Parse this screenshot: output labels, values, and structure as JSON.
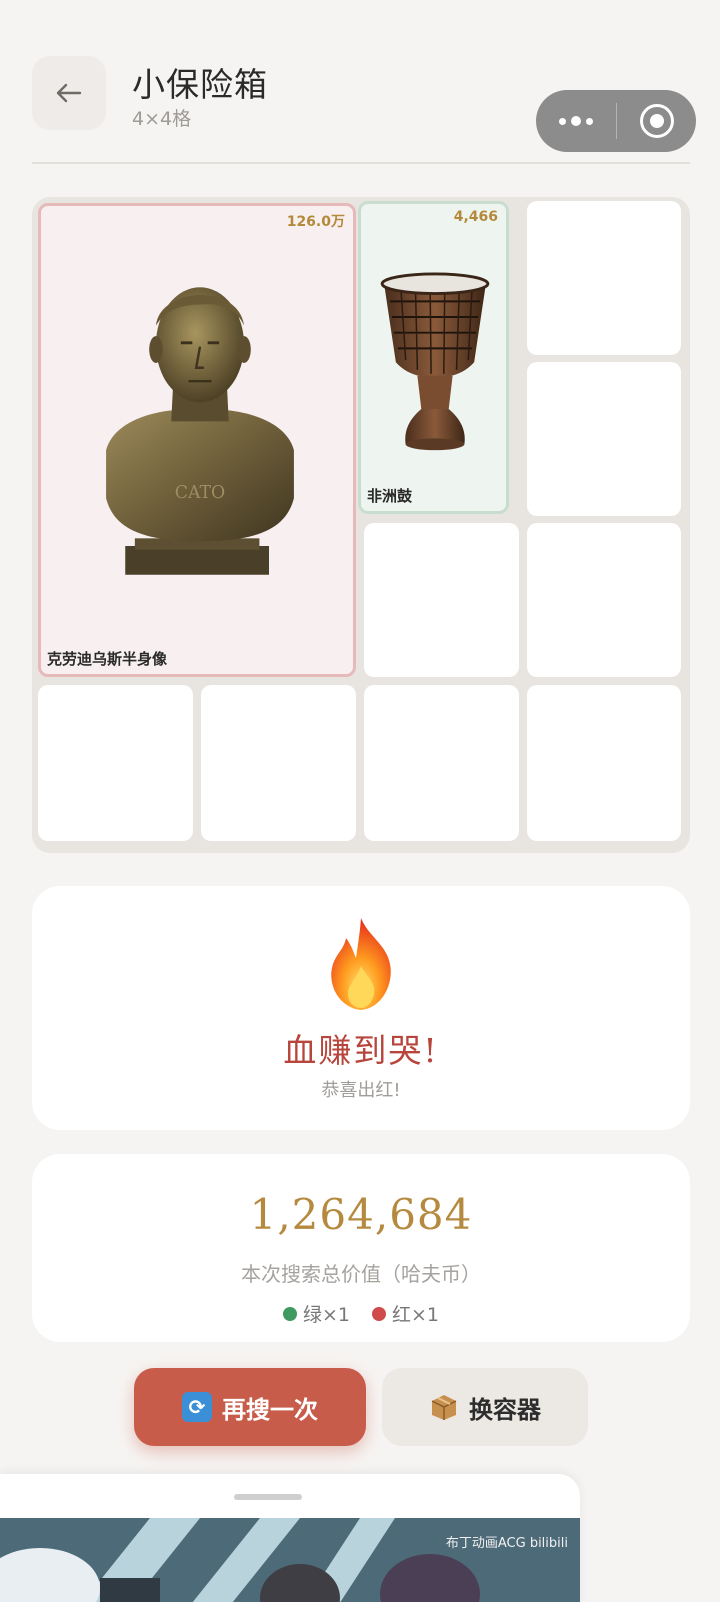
{
  "header": {
    "back_icon": "arrow-left-icon",
    "title": "小保险箱",
    "subtitle": "4×4格",
    "capsule": {
      "more_icon": "more-dots-icon",
      "close_icon": "target-icon"
    }
  },
  "grid": {
    "rows": 4,
    "cols": 4,
    "items": [
      {
        "name": "克劳迪乌斯半身像",
        "value": "126.0万",
        "rarity": "red",
        "icon": "bust-statue-icon",
        "inscription": "CATO"
      },
      {
        "name": "非洲鼓",
        "value": "4,466",
        "rarity": "green",
        "icon": "djembe-drum-icon"
      }
    ]
  },
  "result": {
    "icon": "fire-icon",
    "title": "血赚到哭!",
    "subtitle": "恭喜出红!"
  },
  "summary": {
    "total": "1,264,684",
    "label": "本次搜索总价值（哈夫币）",
    "counts": [
      {
        "label": "绿×1",
        "color": "#3f9a5f"
      },
      {
        "label": "红×1",
        "color": "#cf4a4a"
      }
    ]
  },
  "actions": {
    "retry": {
      "icon": "refresh-icon",
      "label": "再搜一次"
    },
    "switch": {
      "icon": "box-icon",
      "label": "换容器"
    }
  },
  "ad": {
    "brand": "布丁动画ACG  bilibili"
  },
  "colors": {
    "accent": "#c85c4a",
    "gold": "#b58a3e",
    "red_item_border": "#e6b9bb",
    "green_item_border": "#c9ddcf"
  }
}
